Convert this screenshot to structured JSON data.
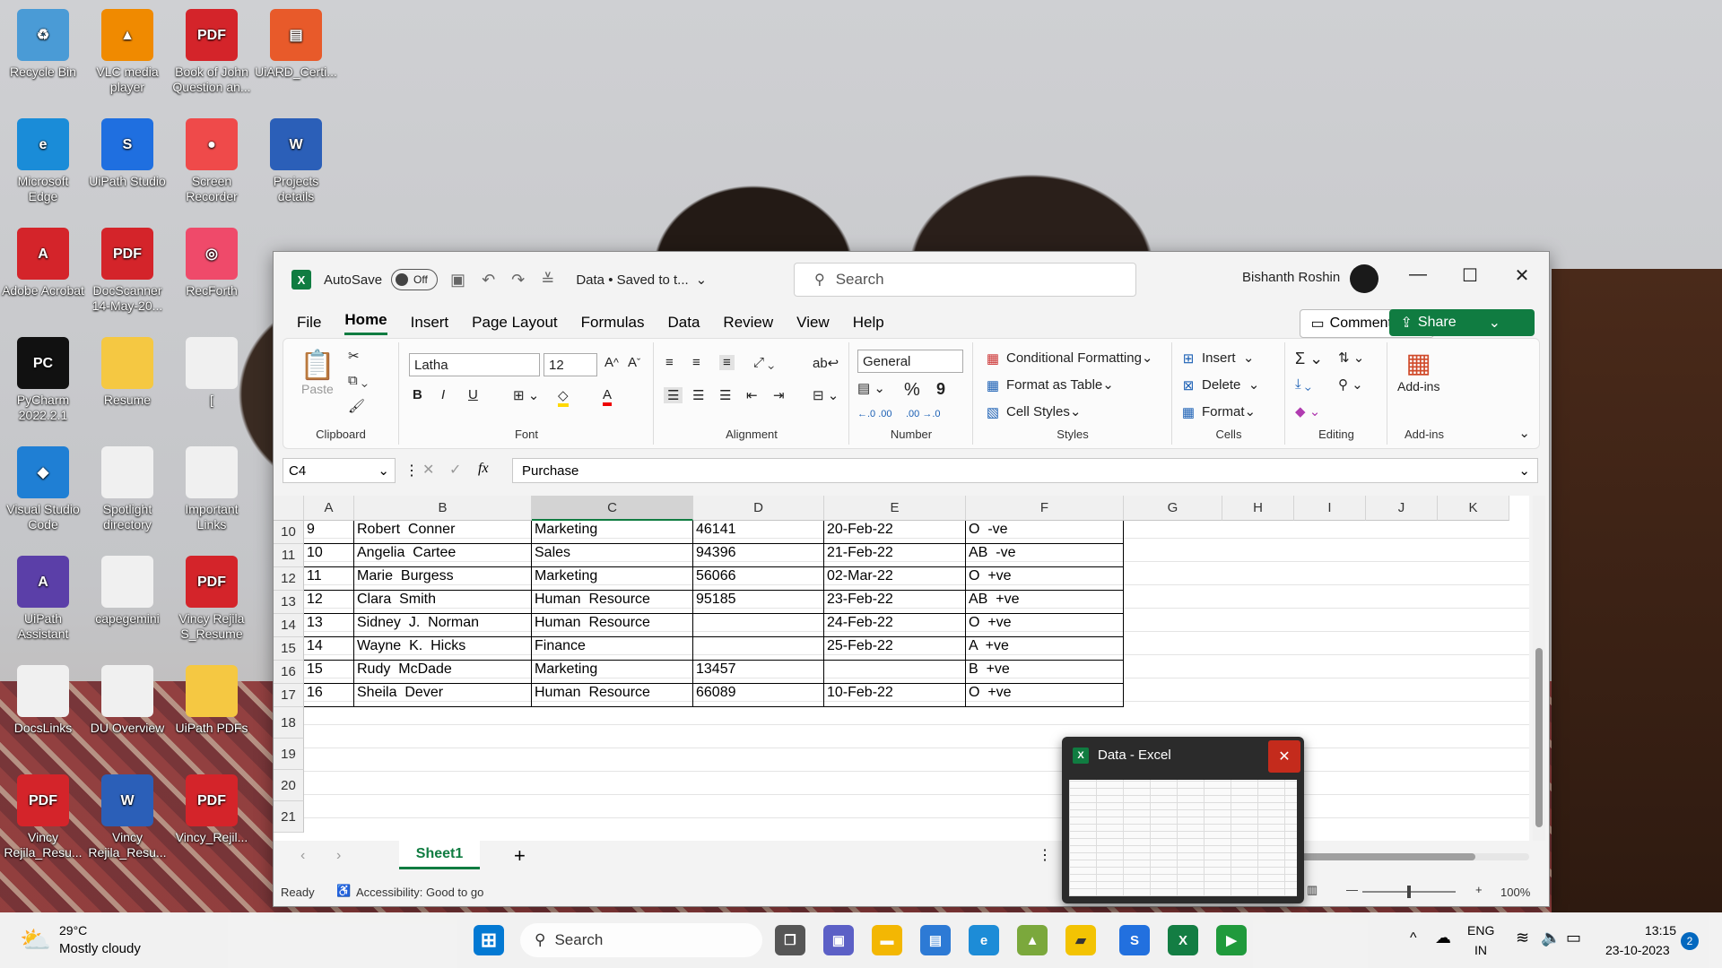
{
  "desktop": {
    "icons": [
      {
        "label": "Recycle Bin",
        "glyph": "♻",
        "color": "#4a9bd6"
      },
      {
        "label": "VLC media player",
        "glyph": "▲",
        "color": "#f08a00"
      },
      {
        "label": "Book of John Question an...",
        "glyph": "PDF",
        "color": "#d4242a"
      },
      {
        "label": "UiARD_Certi...",
        "glyph": "▤",
        "color": "#e85a2a"
      },
      {
        "label": "Microsoft Edge",
        "glyph": "e",
        "color": "#1a8cd8"
      },
      {
        "label": "UiPath Studio",
        "glyph": "S",
        "color": "#1f6fe0"
      },
      {
        "label": "Screen Recorder",
        "glyph": "●",
        "color": "#ef4a4a"
      },
      {
        "label": "Projects details",
        "glyph": "W",
        "color": "#2b5fb8"
      },
      {
        "label": "Adobe Acrobat",
        "glyph": "A",
        "color": "#d4242a"
      },
      {
        "label": "DocScanner 14-May-20...",
        "glyph": "PDF",
        "color": "#d4242a"
      },
      {
        "label": "RecForth",
        "glyph": "◎",
        "color": "#ef4a6a"
      },
      {
        "label": "PyCharm 2022.2.1",
        "glyph": "PC",
        "color": "#111"
      },
      {
        "label": "Resume",
        "glyph": "",
        "color": "#f5c842"
      },
      {
        "label": "[",
        "glyph": "",
        "color": "#f0f0f0"
      },
      {
        "label": "Visual Studio Code",
        "glyph": "◆",
        "color": "#1f7fd4"
      },
      {
        "label": "Spotlight directory",
        "glyph": "",
        "color": "#f0f0f0"
      },
      {
        "label": "Important Links",
        "glyph": "",
        "color": "#f0f0f0"
      },
      {
        "label": "UiPath Assistant",
        "glyph": "A",
        "color": "#5b3fa8"
      },
      {
        "label": "capegemini",
        "glyph": "",
        "color": "#f0f0f0"
      },
      {
        "label": "Vincy Rejila S_Resume",
        "glyph": "PDF",
        "color": "#d4242a"
      },
      {
        "label": "DocsLinks",
        "glyph": "",
        "color": "#f0f0f0"
      },
      {
        "label": "DU Overview",
        "glyph": "",
        "color": "#f0f0f0"
      },
      {
        "label": "UiPath PDFs",
        "glyph": "",
        "color": "#f5c842"
      },
      {
        "label": "Vincy Rejila_Resu...",
        "glyph": "PDF",
        "color": "#d4242a"
      },
      {
        "label": "Vincy Rejila_Resu...",
        "glyph": "W",
        "color": "#2b5fb8"
      },
      {
        "label": "Vincy_Rejil...",
        "glyph": "PDF",
        "color": "#d4242a"
      }
    ]
  },
  "excel": {
    "autosave_label": "AutoSave",
    "autosave_state": "Off",
    "doc_title": "Data • Saved to t...",
    "search_placeholder": "Search",
    "user_name": "Bishanth Roshin",
    "tabs": [
      "File",
      "Home",
      "Insert",
      "Page Layout",
      "Formulas",
      "Data",
      "Review",
      "View",
      "Help"
    ],
    "active_tab": "Home",
    "comments_label": "Comments",
    "share_label": "Share",
    "ribbon": {
      "clipboard": {
        "paste": "Paste",
        "label": "Clipboard"
      },
      "font": {
        "name": "Latha",
        "size": "12",
        "bold": "B",
        "italic": "I",
        "underline": "U",
        "label": "Font"
      },
      "alignment": {
        "label": "Alignment"
      },
      "number": {
        "format": "General",
        "percent": "%",
        "comma": "9",
        "inc": "←.0 .00",
        "dec": ".00 →.0",
        "label": "Number"
      },
      "styles": {
        "conditional": "Conditional Formatting",
        "table": "Format as Table",
        "cell_styles": "Cell Styles",
        "label": "Styles"
      },
      "cells": {
        "insert": "Insert",
        "delete": "Delete",
        "format": "Format",
        "label": "Cells"
      },
      "editing": {
        "label": "Editing"
      },
      "addins": {
        "button": "Add-ins",
        "label": "Add-ins"
      }
    },
    "name_box": "C4",
    "formula_value": "Purchase",
    "columns": [
      "A",
      "B",
      "C",
      "D",
      "E",
      "F",
      "G",
      "H",
      "I",
      "J",
      "K"
    ],
    "rows": [
      {
        "num": "10",
        "cells": [
          "9",
          "Robert  Conner",
          "Marketing",
          "46141",
          "20-Feb-22",
          "O  -ve"
        ]
      },
      {
        "num": "11",
        "cells": [
          "10",
          "Angelia  Cartee",
          "Sales",
          "94396",
          "21-Feb-22",
          "AB  -ve"
        ]
      },
      {
        "num": "12",
        "cells": [
          "11",
          "Marie  Burgess",
          "Marketing",
          "56066",
          "02-Mar-22",
          "O  +ve"
        ]
      },
      {
        "num": "13",
        "cells": [
          "12",
          "Clara  Smith",
          "Human  Resource",
          "95185",
          "23-Feb-22",
          "AB  +ve"
        ]
      },
      {
        "num": "14",
        "cells": [
          "13",
          "Sidney  J.  Norman",
          "Human  Resource",
          "",
          "24-Feb-22",
          "O  +ve"
        ]
      },
      {
        "num": "15",
        "cells": [
          "14",
          "Wayne  K.  Hicks",
          "Finance",
          "",
          "25-Feb-22",
          "A  +ve"
        ]
      },
      {
        "num": "16",
        "cells": [
          "15",
          "Rudy  McDade",
          "Marketing",
          "13457",
          "",
          "B  +ve"
        ]
      },
      {
        "num": "17",
        "cells": [
          "16",
          "Sheila  Dever",
          "Human  Resource",
          "66089",
          "10-Feb-22",
          "O  +ve"
        ]
      }
    ],
    "empty_rows": [
      "18",
      "19",
      "20",
      "21"
    ],
    "sheet_tab": "Sheet1",
    "status_ready": "Ready",
    "status_accessibility": "Accessibility: Good to go",
    "zoom": "100%"
  },
  "preview": {
    "title": "Data - Excel"
  },
  "taskbar": {
    "weather_temp": "29°C",
    "weather_desc": "Mostly cloudy",
    "search_label": "Search",
    "lang_top": "ENG",
    "lang_bottom": "IN",
    "time": "13:15",
    "date": "23-10-2023",
    "notif_count": "2"
  }
}
